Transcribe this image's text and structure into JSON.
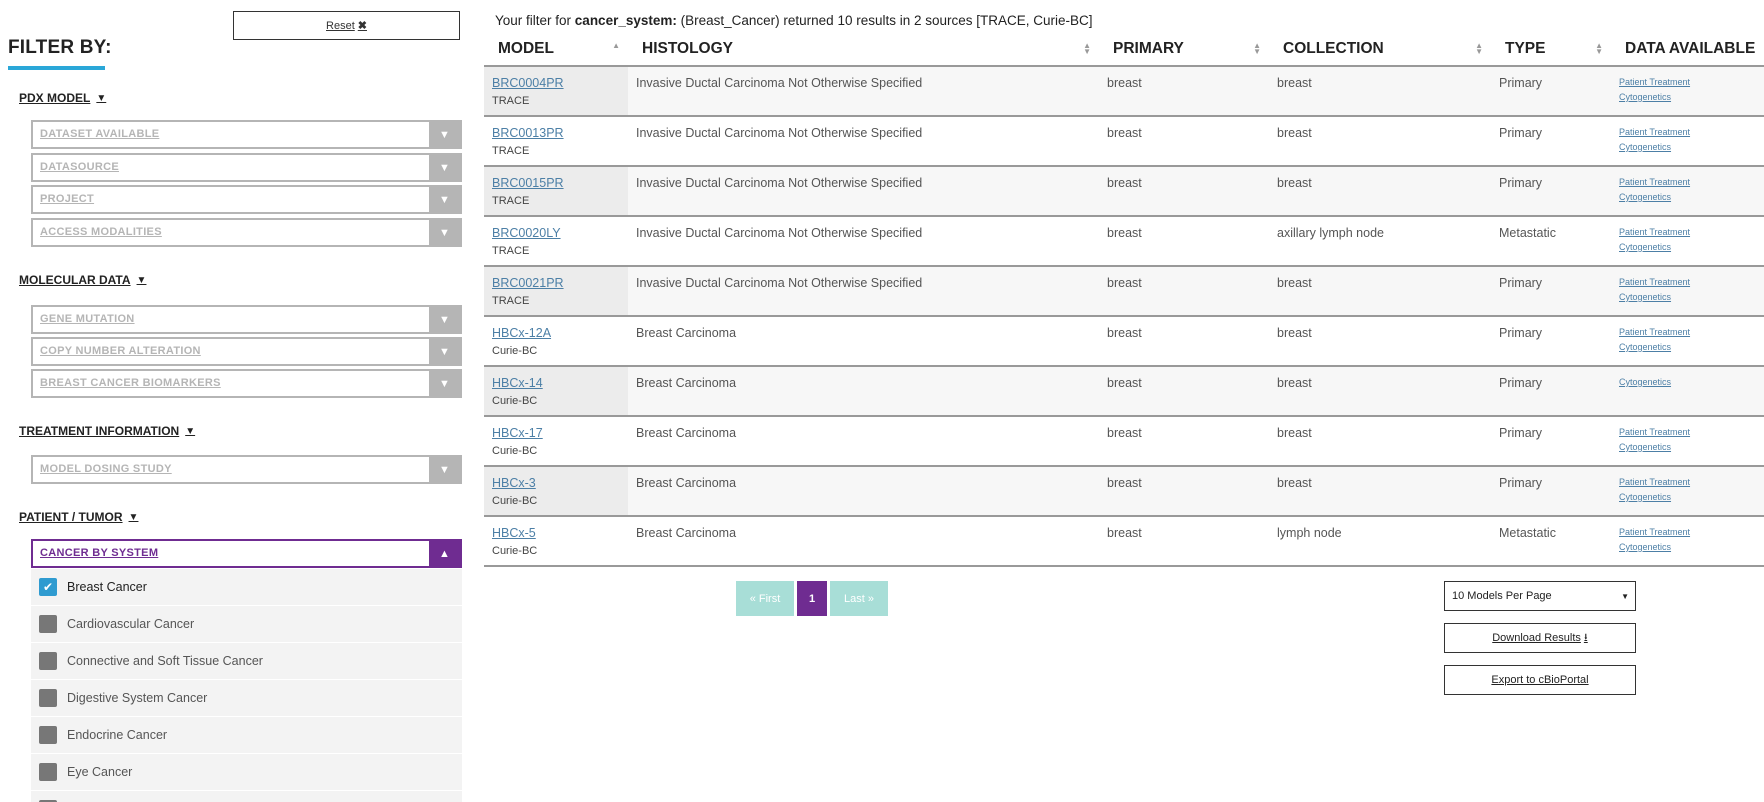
{
  "sidebar": {
    "reset_label": "Reset",
    "filter_title": "FILTER BY:",
    "sections": {
      "pdx_model": "PDX MODEL",
      "molecular": "MOLECULAR DATA",
      "treatment": "TREATMENT INFORMATION",
      "patient": "PATIENT / TUMOR"
    },
    "dropdowns": {
      "dataset_available": "DATASET AVAILABLE",
      "datasource": "DATASOURCE",
      "project": "PROJECT",
      "access_modalities": "ACCESS MODALITIES",
      "gene_mutation": "GENE MUTATION",
      "copy_number": "COPY NUMBER ALTERATION",
      "breast_biomarkers": "BREAST CANCER BIOMARKERS",
      "model_dosing": "MODEL DOSING STUDY",
      "cancer_by_system": "CANCER BY SYSTEM"
    },
    "cancer_options": [
      {
        "label": "Breast Cancer",
        "checked": true
      },
      {
        "label": "Cardiovascular Cancer",
        "checked": false
      },
      {
        "label": "Connective and Soft Tissue Cancer",
        "checked": false
      },
      {
        "label": "Digestive System Cancer",
        "checked": false
      },
      {
        "label": "Endocrine Cancer",
        "checked": false
      },
      {
        "label": "Eye Cancer",
        "checked": false
      },
      {
        "label": "",
        "checked": false
      }
    ]
  },
  "summary": {
    "prefix": "Your filter for ",
    "field": "cancer_system:",
    "suffix": " (Breast_Cancer) returned 10 results in 2 sources [TRACE, Curie-BC]"
  },
  "table": {
    "headers": [
      "MODEL",
      "HISTOLOGY",
      "PRIMARY",
      "COLLECTION",
      "TYPE",
      "DATA AVAILABLE"
    ],
    "rows": [
      {
        "model": "BRC0004PR",
        "source": "TRACE",
        "histology": "Invasive Ductal Carcinoma Not Otherwise Specified",
        "primary": "breast",
        "collection": "breast",
        "type": "Primary",
        "data": [
          "Patient Treatment",
          "Cytogenetics"
        ]
      },
      {
        "model": "BRC0013PR",
        "source": "TRACE",
        "histology": "Invasive Ductal Carcinoma Not Otherwise Specified",
        "primary": "breast",
        "collection": "breast",
        "type": "Primary",
        "data": [
          "Patient Treatment",
          "Cytogenetics"
        ]
      },
      {
        "model": "BRC0015PR",
        "source": "TRACE",
        "histology": "Invasive Ductal Carcinoma Not Otherwise Specified",
        "primary": "breast",
        "collection": "breast",
        "type": "Primary",
        "data": [
          "Patient Treatment",
          "Cytogenetics"
        ]
      },
      {
        "model": "BRC0020LY",
        "source": "TRACE",
        "histology": "Invasive Ductal Carcinoma Not Otherwise Specified",
        "primary": "breast",
        "collection": "axillary lymph node",
        "type": "Metastatic",
        "data": [
          "Patient Treatment",
          "Cytogenetics"
        ]
      },
      {
        "model": "BRC0021PR",
        "source": "TRACE",
        "histology": "Invasive Ductal Carcinoma Not Otherwise Specified",
        "primary": "breast",
        "collection": "breast",
        "type": "Primary",
        "data": [
          "Patient Treatment",
          "Cytogenetics"
        ]
      },
      {
        "model": "HBCx-12A",
        "source": "Curie-BC",
        "histology": "Breast Carcinoma",
        "primary": "breast",
        "collection": "breast",
        "type": "Primary",
        "data": [
          "Patient Treatment",
          "Cytogenetics"
        ]
      },
      {
        "model": "HBCx-14",
        "source": "Curie-BC",
        "histology": "Breast Carcinoma",
        "primary": "breast",
        "collection": "breast",
        "type": "Primary",
        "data": [
          "Cytogenetics"
        ]
      },
      {
        "model": "HBCx-17",
        "source": "Curie-BC",
        "histology": "Breast Carcinoma",
        "primary": "breast",
        "collection": "breast",
        "type": "Primary",
        "data": [
          "Patient Treatment",
          "Cytogenetics"
        ]
      },
      {
        "model": "HBCx-3",
        "source": "Curie-BC",
        "histology": "Breast Carcinoma",
        "primary": "breast",
        "collection": "breast",
        "type": "Primary",
        "data": [
          "Patient Treatment",
          "Cytogenetics"
        ]
      },
      {
        "model": "HBCx-5",
        "source": "Curie-BC",
        "histology": "Breast Carcinoma",
        "primary": "breast",
        "collection": "lymph node",
        "type": "Metastatic",
        "data": [
          "Patient Treatment",
          "Cytogenetics"
        ]
      }
    ]
  },
  "pagination": {
    "first": "« First",
    "current": "1",
    "last": "Last »"
  },
  "per_page": "10 Models Per Page",
  "download_label": "Download Results",
  "export_label": "Export to cBioPortal",
  "colors": {
    "accent_purple": "#6f2c91",
    "accent_blue": "#2aa7d8",
    "pager_disabled": "#a8ded7",
    "link": "#4c7fa6"
  },
  "icons": {
    "reset": "close-icon",
    "section": "chevron-down-icon",
    "dropdown": "chevron-down-icon",
    "active_dropdown": "chevron-up-icon",
    "checkbox": "check-icon",
    "download": "download-icon",
    "sort": "sort-icon"
  }
}
